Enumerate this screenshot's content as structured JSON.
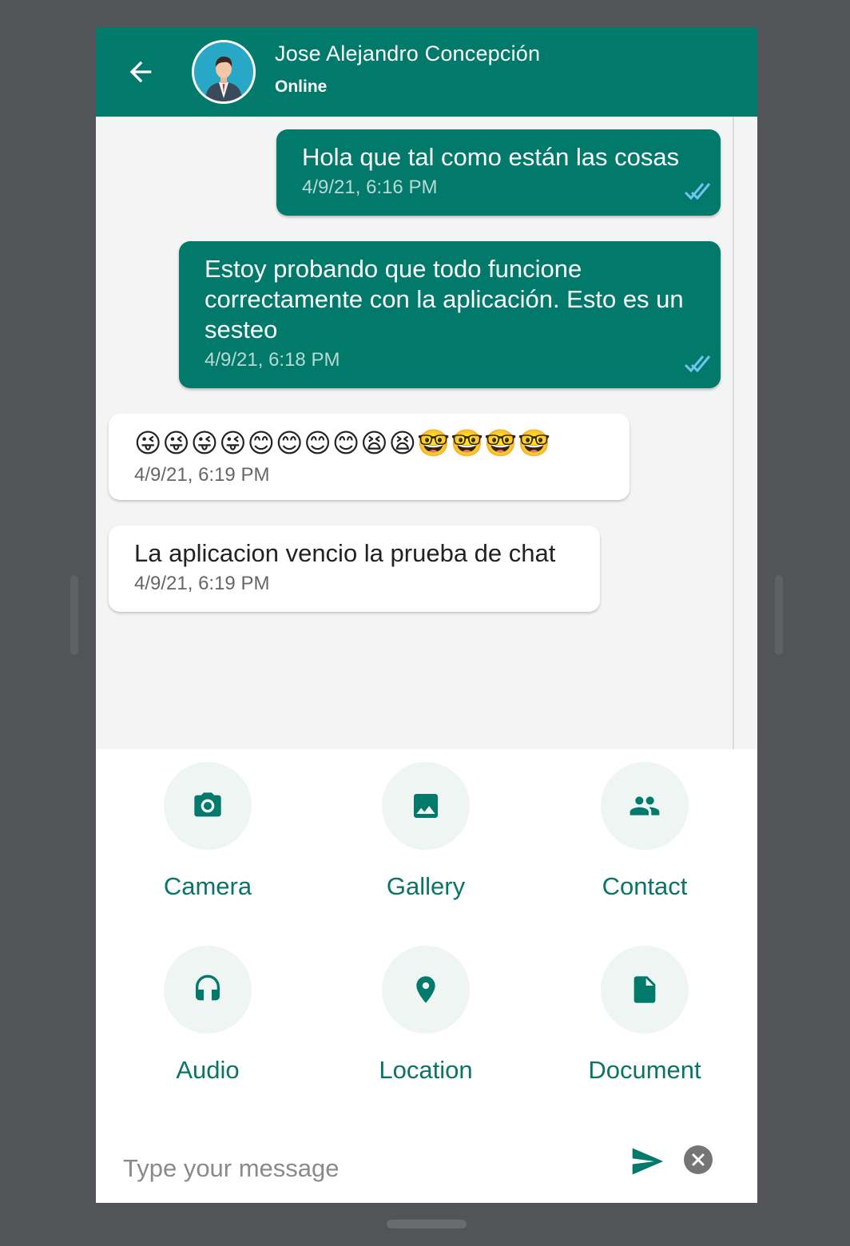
{
  "header": {
    "contact_name": "Jose Alejandro Concepción",
    "status": "Online"
  },
  "messages": [
    {
      "direction": "out",
      "text": "Hola que tal como están las cosas",
      "time": "4/9/21, 6:16 PM",
      "read": true
    },
    {
      "direction": "out",
      "text": "Estoy probando que todo funcione correctamente con la aplicación. Esto es un sesteo",
      "time": "4/9/21, 6:18 PM",
      "read": true
    },
    {
      "direction": "in",
      "text": "😜😜😜😜😊😊😊😊😫😫🤓🤓🤓🤓",
      "time": "4/9/21, 6:19 PM"
    },
    {
      "direction": "in",
      "text": "La aplicacion vencio la prueba de chat",
      "time": "4/9/21, 6:19 PM"
    }
  ],
  "attachments": [
    {
      "label": "Camera",
      "icon": "camera-icon"
    },
    {
      "label": "Gallery",
      "icon": "image-icon"
    },
    {
      "label": "Contact",
      "icon": "people-icon"
    },
    {
      "label": "Audio",
      "icon": "headphones-icon"
    },
    {
      "label": "Location",
      "icon": "location-pin-icon"
    },
    {
      "label": "Document",
      "icon": "document-icon"
    }
  ],
  "composer": {
    "placeholder": "Type your message",
    "value": ""
  },
  "colors": {
    "primary": "#01796b",
    "read_tick": "#6ec6ee",
    "screen_background": "#f4f4f4",
    "outer_background": "#535457"
  }
}
